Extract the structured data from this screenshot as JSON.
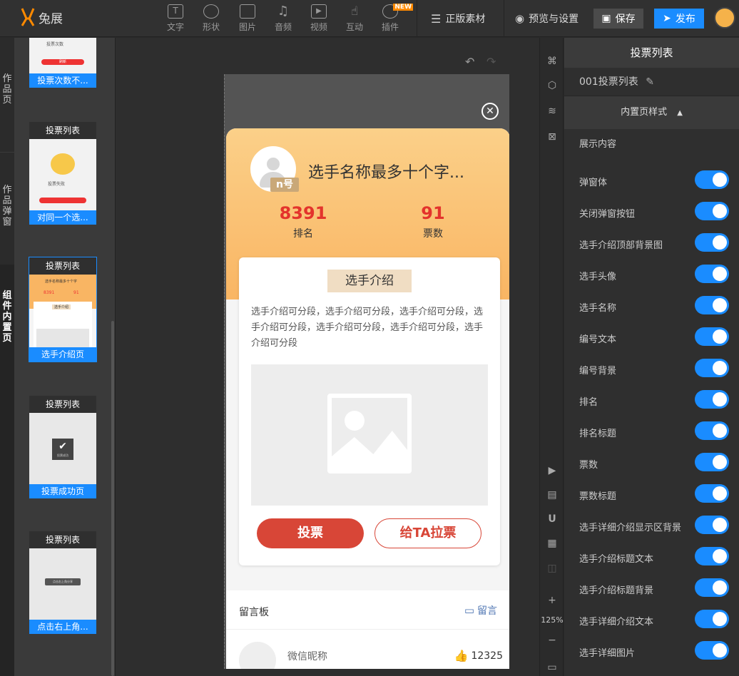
{
  "app": {
    "logo_text": "兔展"
  },
  "toolbar": {
    "tools": [
      {
        "label": "文字",
        "icon": "text-icon"
      },
      {
        "label": "形状",
        "icon": "shape-icon"
      },
      {
        "label": "图片",
        "icon": "image-icon"
      },
      {
        "label": "音频",
        "icon": "music-icon"
      },
      {
        "label": "视频",
        "icon": "video-icon"
      },
      {
        "label": "互动",
        "icon": "hand-icon"
      },
      {
        "label": "插件",
        "icon": "plugin-icon",
        "badge": "NEW"
      }
    ],
    "stock": "正版素材",
    "preview": "预览与设置",
    "save": "保存",
    "publish": "发布"
  },
  "left_categories": [
    {
      "label": "作\n品\n页"
    },
    {
      "label": "作\n品\n弹\n窗"
    },
    {
      "label": "组\n件\n内\n置\n页"
    }
  ],
  "thumbnails": [
    {
      "title": "",
      "caption": "投票次数不..."
    },
    {
      "title": "投票列表",
      "caption": "对同一个选..."
    },
    {
      "title": "投票列表",
      "caption": "选手介绍页",
      "active": true
    },
    {
      "title": "投票列表",
      "caption": "投票成功页"
    },
    {
      "title": "投票列表",
      "caption": "点击右上角..."
    }
  ],
  "thumb_text": {
    "t1_line": "投票次数",
    "t1_btn": "刷新",
    "t2_line": "投票失败",
    "t3_stat1": "8391",
    "t3_stat2": "91",
    "t3_head": "选手名称最多十个字",
    "t3_title": "选手介绍",
    "t4_text": "投票成功",
    "t5_text": "点击右上角分享"
  },
  "canvas": {
    "undo": "↶",
    "redo": "↷"
  },
  "popup": {
    "close": "✕",
    "badge": "n号",
    "player_name": "选手名称最多十个字...",
    "rank_value": "8391",
    "rank_label": "排名",
    "votes_value": "91",
    "votes_label": "票数",
    "intro_title": "选手介绍",
    "intro_text": "选手介绍可分段，选手介绍可分段，选手介绍可分段，选手介绍可分段，选手介绍可分段，选手介绍可分段，选手介绍可分段",
    "vote_button": "投票",
    "pull_button": "给TA拉票",
    "board_title": "留言板",
    "board_msg": "留言",
    "commenter": "微信昵称",
    "likes": "12325"
  },
  "zoom": "125%",
  "panel": {
    "header": "投票列表",
    "name": "001投票列表",
    "section": "内置页样式",
    "content_label": "展示内容",
    "toggles": [
      {
        "label": "弹窗体",
        "on": true
      },
      {
        "label": "关闭弹窗按钮",
        "on": true
      },
      {
        "label": "选手介绍顶部背景图",
        "on": true
      },
      {
        "label": "选手头像",
        "on": true
      },
      {
        "label": "选手名称",
        "on": true
      },
      {
        "label": "编号文本",
        "on": true
      },
      {
        "label": "编号背景",
        "on": true
      },
      {
        "label": "排名",
        "on": true
      },
      {
        "label": "排名标题",
        "on": true
      },
      {
        "label": "票数",
        "on": true
      },
      {
        "label": "票数标题",
        "on": true
      },
      {
        "label": "选手详细介绍显示区背景",
        "on": true
      },
      {
        "label": "选手介绍标题文本",
        "on": true
      },
      {
        "label": "选手介绍标题背景",
        "on": true
      },
      {
        "label": "选手详细介绍文本",
        "on": true
      },
      {
        "label": "选手详细图片",
        "on": true
      }
    ]
  },
  "colors": {
    "accent": "#1a8cff",
    "vote_red": "#d84637",
    "stat_red": "#e3332c",
    "card_orange": "#f9b563"
  }
}
